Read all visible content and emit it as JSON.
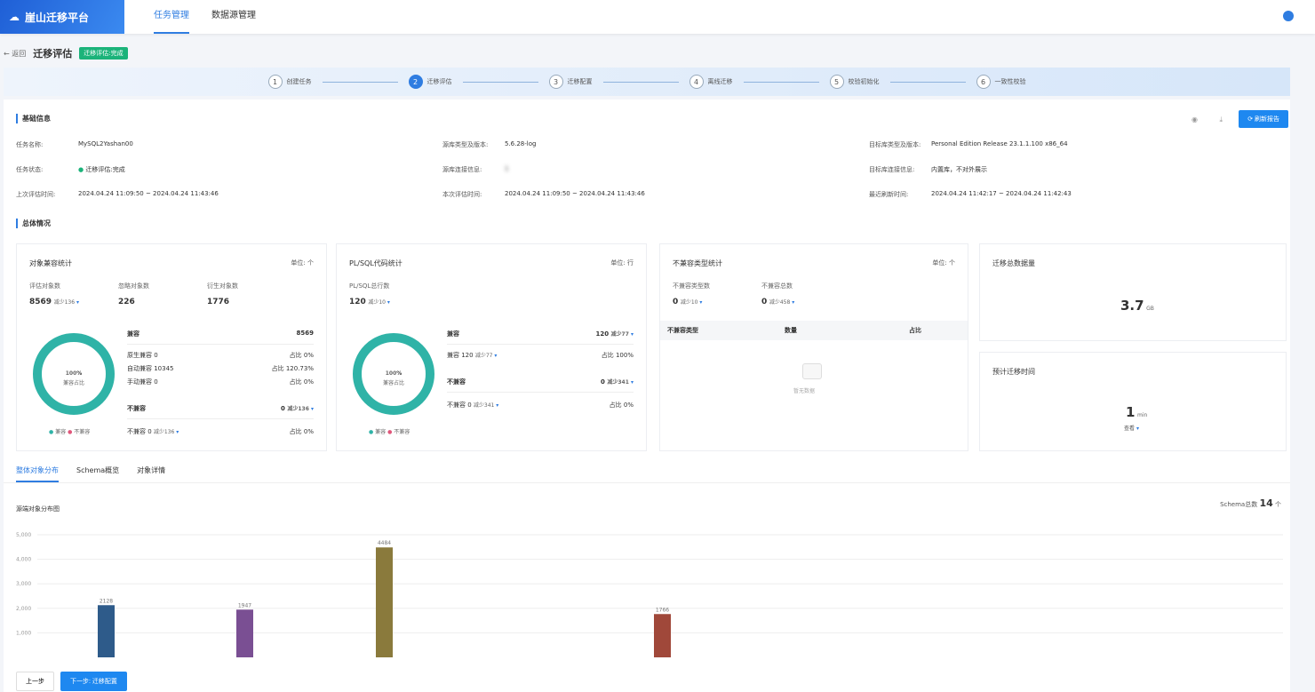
{
  "header": {
    "brand": "崖山迁移平台",
    "nav": [
      "任务管理",
      "数据源管理"
    ]
  },
  "page": {
    "back": "返回",
    "title": "迁移评估",
    "status_tag": "迁移评估:完成"
  },
  "steps": [
    {
      "n": "1",
      "label": "创建任务"
    },
    {
      "n": "2",
      "label": "迁移评估"
    },
    {
      "n": "3",
      "label": "迁移配置"
    },
    {
      "n": "4",
      "label": "离线迁移"
    },
    {
      "n": "5",
      "label": "校验初始化"
    },
    {
      "n": "6",
      "label": "一致性校验"
    }
  ],
  "basic": {
    "title": "基础信息",
    "refresh": "刷新报告",
    "items": [
      {
        "label": "任务名称:",
        "value": "MySQL2Yashan00"
      },
      {
        "label": "源库类型及版本:",
        "value": "5.6.28-log"
      },
      {
        "label": "目标库类型及版本:",
        "value": "Personal Edition Release 23.1.1.100 x86_64"
      },
      {
        "label": "任务状态:",
        "value": "迁移评估:完成"
      },
      {
        "label": "源库连接信息:",
        "value": "1"
      },
      {
        "label": "目标库连接信息:",
        "value": "内置库，不对外展示"
      },
      {
        "label": "上次评估时间:",
        "value": "2024.04.24 11:09:50 ~ 2024.04.24 11:43:46"
      },
      {
        "label": "本次评估时间:",
        "value": "2024.04.24 11:09:50 ~ 2024.04.24 11:43:46"
      },
      {
        "label": "最近刷新时间:",
        "value": "2024.04.24 11:42:17 ~ 2024.04.24 11:42:43"
      }
    ]
  },
  "overview": {
    "title": "总体情况",
    "obj": {
      "title": "对象兼容统计",
      "unit": "单位: 个",
      "eval_label": "评估对象数",
      "eval": "8569",
      "eval_dec": "减少136",
      "ign_label": "忽略对象数",
      "ign": "226",
      "der_label": "衍生对象数",
      "der": "1776",
      "pct": "100",
      "pct_unit": "%",
      "pct_label": "兼容占比",
      "compat": "兼容",
      "compat_n": "8569",
      "r1": "原生兼容 0",
      "r1p": "占比 0%",
      "r2": "自动兼容 10345",
      "r2p": "占比 120.73%",
      "r3": "手动兼容 0",
      "r3p": "占比 0%",
      "incompat": "不兼容",
      "incompat_n": "0",
      "incompat_dec": "减少136",
      "r4": "不兼容 0",
      "r4d": "减少136",
      "r4p": "占比 0%",
      "leg1": "兼容",
      "leg2": "不兼容"
    },
    "pl": {
      "title": "PL/SQL代码统计",
      "unit": "单位: 行",
      "total_label": "PL/SQL总行数",
      "total": "120",
      "total_dec": "减少10",
      "pct": "100",
      "pct_unit": "%",
      "pct_label": "兼容占比",
      "compat": "兼容",
      "compat_n": "120",
      "compat_dec": "减少77",
      "r1": "兼容 120",
      "r1d": "减少77",
      "r1p": "占比 100%",
      "incompat": "不兼容",
      "incompat_n": "0",
      "incompat_dec": "减少341",
      "r2": "不兼容 0",
      "r2d": "减少341",
      "r2p": "占比 0%",
      "leg1": "兼容",
      "leg2": "不兼容"
    },
    "inc": {
      "title": "不兼容类型统计",
      "unit": "单位: 个",
      "a_label": "不兼容类型数",
      "a": "0",
      "a_dec": "减少10",
      "b_label": "不兼容总数",
      "b": "0",
      "b_dec": "减少458",
      "cols": [
        "不兼容类型",
        "数量",
        "占比"
      ],
      "empty": "暂无数据"
    },
    "size": {
      "title": "迁移总数据量",
      "value": "3.7",
      "unit": "GB"
    },
    "time": {
      "title": "预计迁移时间",
      "value": "1",
      "unit": "min",
      "sub": "查看"
    }
  },
  "tabs": [
    "整体对象分布",
    "Schema概览",
    "对象详情"
  ],
  "chart_data": {
    "type": "bar",
    "title": "源端对象分布图",
    "schema_label": "Schema总数",
    "schema_count": "14",
    "schema_unit": "个",
    "values": [
      2128,
      1947,
      4484,
      1766
    ],
    "colors": [
      "#2e5b8a",
      "#7a4f93",
      "#8a7a3c",
      "#a0483a"
    ],
    "yticks": [
      "1,000",
      "2,000",
      "3,000",
      "4,000",
      "5,000"
    ],
    "ylim": [
      0,
      5000
    ]
  },
  "footer": {
    "prev": "上一步",
    "next": "下一步: 迁移配置"
  }
}
